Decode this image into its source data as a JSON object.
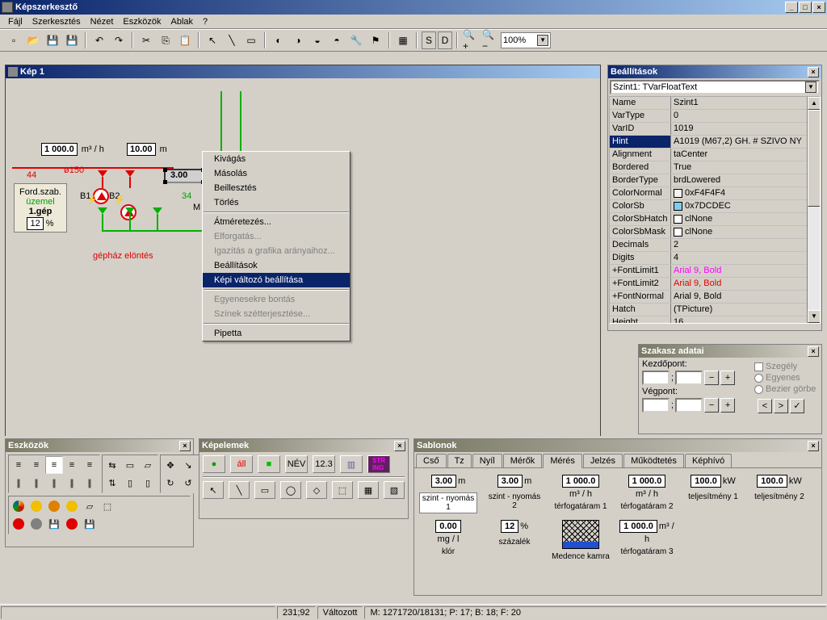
{
  "app_title": "Képszerkesztő",
  "menu": [
    "Fájl",
    "Szerkesztés",
    "Nézet",
    "Eszközök",
    "Ablak",
    "?"
  ],
  "toolbar_icons": [
    "new",
    "open",
    "save",
    "saveall",
    "|",
    "undo",
    "redo",
    "|",
    "cut",
    "copy",
    "paste",
    "|",
    "arrow",
    "line",
    "rect",
    "|",
    "shape1",
    "shape2",
    "shape3",
    "shape4",
    "wrench",
    "flag",
    "|",
    "grid",
    "|",
    "S",
    "D",
    "|",
    "zoomin",
    "zoomout"
  ],
  "zoom_value": "100%",
  "canvas": {
    "title": "Kép 1"
  },
  "diagram": {
    "flow_value": "1 000.0",
    "flow_unit": "m³ / h",
    "level_value": "10.00",
    "level_unit": "m",
    "arrow_label": "44",
    "pipe_dia": "ø150",
    "small_val": "3.00",
    "ford_title": "Ford.szab.",
    "ford_status": "üzemel",
    "ford_gep": "1.gép",
    "ford_pct": "12",
    "ford_pct_unit": "%",
    "b1": "B1",
    "b2": "B2",
    "green_num": "34",
    "m_lbl": "M",
    "gephaz": "gépház elöntés"
  },
  "context_menu": {
    "items": [
      {
        "t": "Kivágás",
        "en": true
      },
      {
        "t": "Másolás",
        "en": true
      },
      {
        "t": "Beillesztés",
        "en": true
      },
      {
        "t": "Törlés",
        "en": true
      },
      {
        "sep": true
      },
      {
        "t": "Átméretezés...",
        "en": true
      },
      {
        "t": "Elforgatás...",
        "en": false
      },
      {
        "t": "Igazítás a grafika arányaihoz...",
        "en": false
      },
      {
        "t": "Beállítások",
        "en": true
      },
      {
        "t": "Képi változó beállítása",
        "en": true,
        "sel": true
      },
      {
        "sep": true
      },
      {
        "t": "Egyenesekre bontás",
        "en": false
      },
      {
        "t": "Színek szétterjesztése...",
        "en": false
      },
      {
        "sep": true
      },
      {
        "t": "Pipetta",
        "en": true
      }
    ]
  },
  "props": {
    "title": "Beállítások",
    "selected": "Szint1: TVarFloatText",
    "rows": [
      {
        "n": "Name",
        "v": "Szint1"
      },
      {
        "n": "VarType",
        "v": "0"
      },
      {
        "n": "VarID",
        "v": "1019"
      },
      {
        "n": "Hint",
        "v": "A1019 (M67,2)  GH.    # SZIVO NY",
        "sel": true
      },
      {
        "n": "Alignment",
        "v": "taCenter"
      },
      {
        "n": "Bordered",
        "v": "True"
      },
      {
        "n": "BorderType",
        "v": "brdLowered"
      },
      {
        "n": "ColorNormal",
        "v": "0xF4F4F4",
        "sw": "#f4f4f4"
      },
      {
        "n": "ColorSb",
        "v": "0x7DCDEC",
        "sw": "#7dcdec"
      },
      {
        "n": "ColorSbHatch",
        "v": "clNone",
        "sw": "#fff"
      },
      {
        "n": "ColorSbMask",
        "v": "clNone",
        "sw": "#fff"
      },
      {
        "n": "Decimals",
        "v": "2"
      },
      {
        "n": "Digits",
        "v": "4"
      },
      {
        "n": "+FontLimit1",
        "v": "Arial 9, Bold",
        "col": "#ff00ff"
      },
      {
        "n": "+FontLimit2",
        "v": "Arial 9, Bold",
        "col": "#e00000"
      },
      {
        "n": "+FontNormal",
        "v": "Arial 9, Bold"
      },
      {
        "n": "Hatch",
        "v": "(TPicture)"
      },
      {
        "n": "Height",
        "v": "16"
      }
    ]
  },
  "szakasz": {
    "title": "Szakasz adatai",
    "kezd": "Kezdőpont:",
    "veg": "Végpont:",
    "szegely": "Szegély",
    "egyenes": "Egyenes",
    "bezier": "Bezier görbe"
  },
  "eszk": {
    "title": "Eszközök"
  },
  "kepelemek": {
    "title": "Képelemek",
    "row1": [
      {
        "g": "●",
        "c": "#00a000"
      },
      {
        "g": "áll",
        "c": "#e00000"
      },
      {
        "g": "■",
        "c": "#00c000"
      },
      {
        "g": "NÉV",
        "c": "#000"
      },
      {
        "g": "12.3",
        "c": "#000"
      },
      {
        "g": "▥",
        "c": "#6060a0"
      },
      {
        "g": "STR\nING",
        "c": "#ff00ff",
        "bg": "#602060"
      }
    ],
    "row2": [
      "↖",
      "╲",
      "▭",
      "◯",
      "◇",
      "⬚",
      "▦",
      "▧"
    ]
  },
  "sablonok": {
    "title": "Sablonok",
    "tabs": [
      "Cső",
      "Tz",
      "Nyíl",
      "Mérők",
      "Mérés",
      "Jelzés",
      "Működtetés",
      "Képhívó"
    ],
    "active_tab": "Mérés",
    "measures": [
      {
        "v": "3.00",
        "u": "m",
        "l": "szint - nyomás 1",
        "boxed": true
      },
      {
        "v": "3.00",
        "u": "m",
        "l": "szint - nyomás 2"
      },
      {
        "v": "1 000.0",
        "u": "m³ / h",
        "l": "térfogatáram 1",
        "stack": true
      },
      {
        "v": "1 000.0",
        "u": "m³ / h",
        "l": "térfogatáram 2",
        "stack": true
      },
      {
        "v": "100.0",
        "u": "kW",
        "l": "teljesítmény 1"
      },
      {
        "v": "100.0",
        "u": "kW",
        "l": "teljesítmény 2"
      }
    ],
    "measures2": [
      {
        "v": "0.00",
        "u": "mg / l",
        "l": "klór",
        "stack": true
      },
      {
        "v": "12",
        "u": "%",
        "l": "százalék"
      },
      {
        "img": true,
        "l": "Medence kamra"
      },
      {
        "v": "1 000.0",
        "u": "m³ / h",
        "l": "térfogatáram 3"
      }
    ]
  },
  "statusbar": {
    "coord": "231;92",
    "changed": "Változott",
    "info": "M: 1271720/18131; P: 17; B: 18; F: 20"
  }
}
